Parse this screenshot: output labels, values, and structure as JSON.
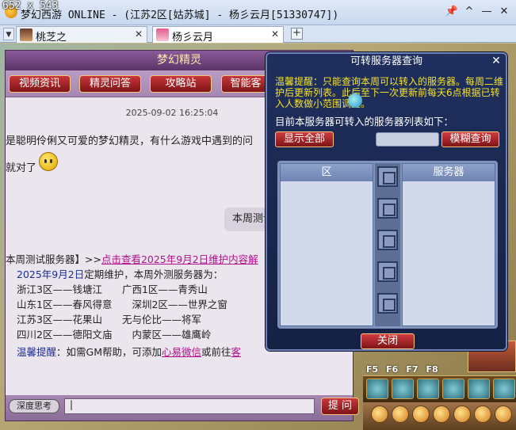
{
  "window": {
    "title": "梦幻西游 ONLINE - (江苏2区[姑苏城] - 杨彡云月[51330747])",
    "controls": [
      "📌",
      "^",
      "—",
      "✕"
    ]
  },
  "size_overlay": "652 x 543",
  "tabs": [
    {
      "label": "桃芝之",
      "close": "✕",
      "active": false
    },
    {
      "label": "杨彡云月",
      "close": "✕",
      "active": true
    }
  ],
  "tab_add": "+",
  "chat": {
    "header": "梦幻精灵",
    "toolbar": [
      "视频资讯",
      "精灵问答",
      "攻略站",
      "智能客"
    ],
    "timestamp": "2025-09-02 16:25:04",
    "greeting_line1": "是聪明伶俐又可爱的梦幻精灵，有什么游戏中遇到的问",
    "greeting_line2": "就对了",
    "user_msg": "本周测试",
    "reply": {
      "head_prefix": "本周测试服务器】>>",
      "head_link": "点击查看2025年9月2日维护内容解",
      "date": "2025年9月2日",
      "date_suffix": "定期维护，本周外测服务器为：",
      "rows": [
        "浙江3区——钱塘江　　广西1区——青秀山",
        "山东1区——春风得意　　深圳2区——世界之窗",
        "江苏3区——花果山　　无与伦比——将军",
        "四川2区——德阳文庙　　内蒙区——雄鹰岭"
      ],
      "tip_label": "温馨提醒",
      "tip_text": "：如需GM帮助，可添加",
      "tip_link1": "心易微信",
      "tip_mid": "或前往",
      "tip_link2": "客"
    },
    "scroll_plus": "+",
    "deep_think": "深度思考",
    "input_value": "|",
    "ask_label": "提 问"
  },
  "dialog": {
    "title": "可转服务器查询",
    "close": "✕",
    "tip": "温馨提醒：只能查询本周可以转入的服务器。每周二维护后更新列表。此后至下一次更新前每天6点根据已转入人数做小范围调整。",
    "list_desc": "目前本服务器可转入的服务器列表如下：",
    "show_all": "显示全部",
    "search_value": "",
    "fuzzy_search": "模糊查询",
    "col_zone": "区",
    "col_server": "服务器",
    "close_btn": "关闭"
  },
  "game_hud": {
    "keys": [
      "F5",
      "F6",
      "F7",
      "F8"
    ]
  }
}
